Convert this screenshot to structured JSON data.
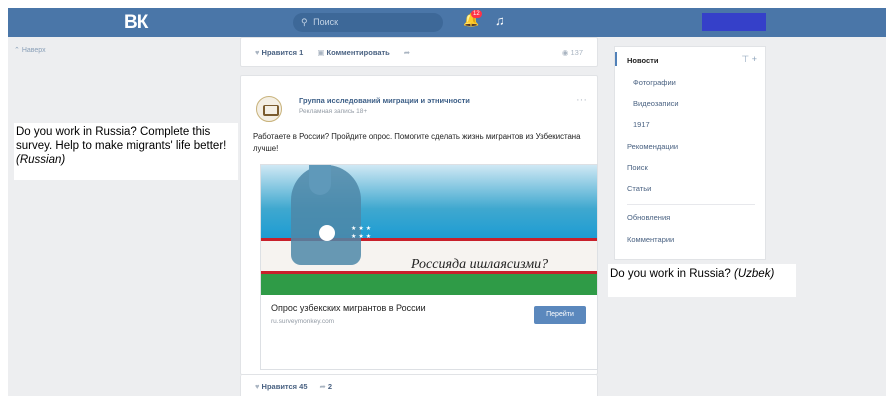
{
  "topbar": {
    "logo": "ВК",
    "search_placeholder": "Поиск",
    "notification_count": "12",
    "accent": "#4a76a8"
  },
  "left": {
    "back_label": "Наверх"
  },
  "annotations": {
    "left_text": "Do you work in Russia? Complete this survey. Help to make migrants' life better!",
    "left_lang": "(Russian)",
    "right_text": "Do you work in Russia?",
    "right_lang": "(Uzbek)"
  },
  "prev_post": {
    "like_label": "Нравится",
    "like_count": "1",
    "comment_label": "Комментировать",
    "views": "137"
  },
  "post": {
    "group_name": "Группа исследований миграции и этничности",
    "sub": "Рекламная запись 18+",
    "text": "Работаете в России? Пройдите опрос. Помогите сделать жизнь мигрантов из Узбекистана лучше!",
    "image_caption": "Россияда ишлаясизми?",
    "ad_title": "Опрос узбекских мигрантов в России",
    "ad_url": "ru.surveymonkey.com",
    "ad_button": "Перейти",
    "like_label": "Нравится",
    "like_count": "45",
    "share_count": "2"
  },
  "right_menu": {
    "items": [
      "Новости",
      "Фотографии",
      "Видеозаписи",
      "1917",
      "Рекомендации",
      "Поиск",
      "Статьи",
      "Обновления",
      "Комментарии"
    ]
  }
}
